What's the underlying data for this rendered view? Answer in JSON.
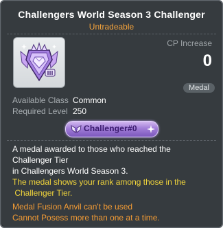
{
  "item": {
    "name": "Challengers World Season 3 Challenger",
    "trade_status": "Untradeable",
    "icon_name": "challenger-medal-icon",
    "cp": {
      "label": "CP Increase",
      "value": "0"
    },
    "category": "Medal",
    "info": [
      {
        "key": "Available Class",
        "value": "Common"
      },
      {
        "key": "Required Level",
        "value": "250"
      }
    ],
    "medal_tag": {
      "text": "Challenger#0"
    },
    "description": {
      "white_lines": [
        "A medal awarded to those who reached the",
        "Challenger Tier",
        "in Challengers World Season 3."
      ],
      "yellow_lines": [
        "The medal shows your rank among those in the",
        " Challenger Tier."
      ],
      "orange_lines": [
        "Medal Fusion Anvil can't be used",
        "Cannot Posess more than one at a time."
      ]
    }
  },
  "colors": {
    "background": "#363b3f",
    "title": "#ffffff",
    "trade_status": "#f4a33c",
    "yellow_text": "#f0d43c",
    "orange_text": "#f49c35",
    "medal_purple": "#a27ed8"
  }
}
